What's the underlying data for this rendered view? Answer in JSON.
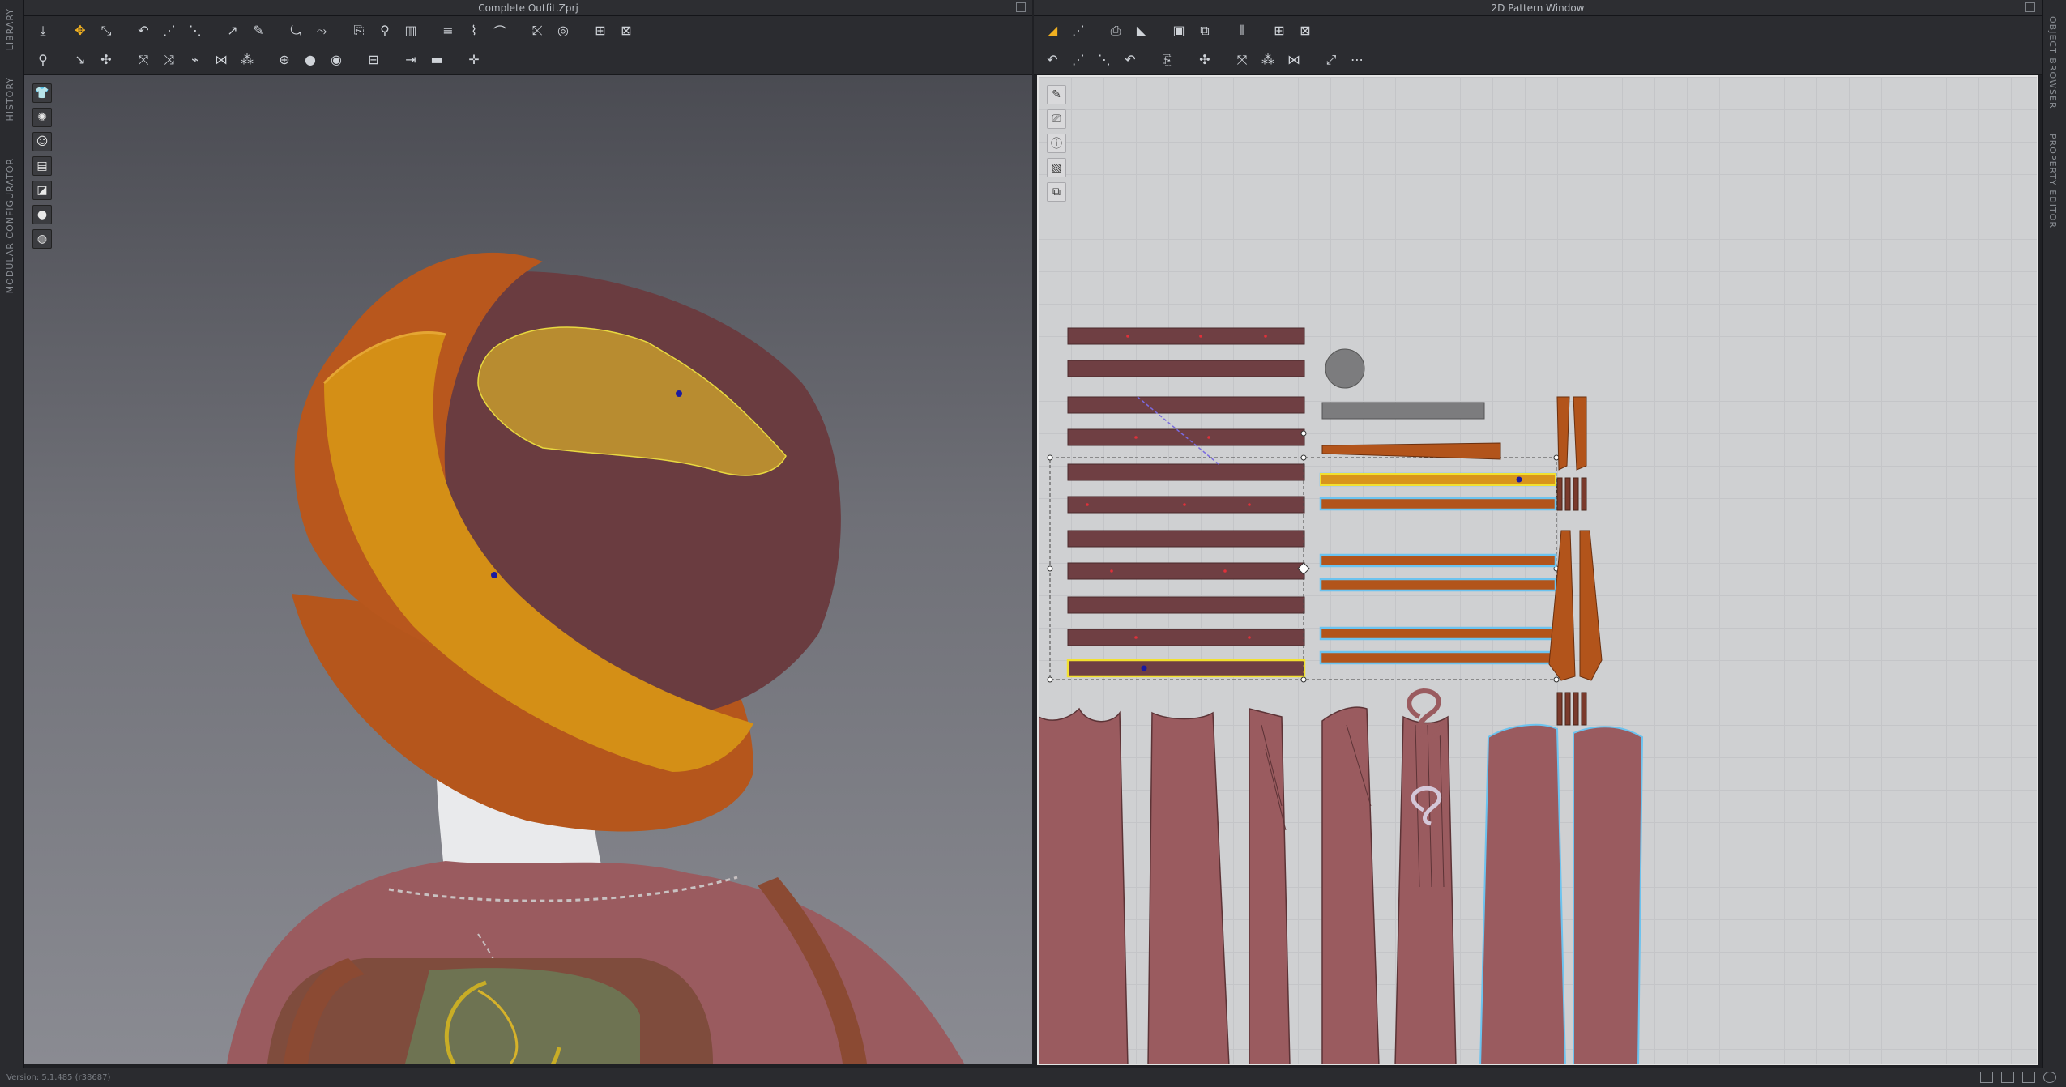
{
  "left_tabs": [
    "LIBRARY",
    "HISTORY",
    "MODULAR CONFIGURATOR"
  ],
  "right_tabs": [
    "OBJECT BROWSER",
    "PROPERTY EDITOR"
  ],
  "pane3d": {
    "title": "Complete Outfit.Zprj"
  },
  "pane2d": {
    "title": "2D Pattern Window"
  },
  "status": {
    "version": "Version: 5.1.485 (r38687)"
  },
  "colors": {
    "fabric_maroon": "#6e3e42",
    "fabric_orange": "#b2541b",
    "fabric_mustard": "#d8941c",
    "selection_yellow": "#f2e030",
    "selection_blue": "#6cc3ef",
    "pattern_grid": "#cfd0d2"
  },
  "icons": {
    "toolbar3d_row1": [
      "avatar-down-icon",
      "select-move-icon",
      "transform-icon",
      "edit-mesh-icon",
      "pin-icon",
      "fold-icon",
      "tack-icon",
      "seam-icon",
      "line-icon",
      "trace-icon",
      "sketch-icon",
      "fit-icon",
      "hanger-icon",
      "grid-icon",
      "grid2-icon"
    ],
    "toolbar3d_row2": [
      "pose-icon",
      "point-icon",
      "arrange-icon",
      "strap-icon",
      "button-icon",
      "topstitch-icon",
      "zipper-icon",
      "measure-icon",
      "tape-icon",
      "fabric-icon",
      "avatar-measure-icon",
      "ruler-icon",
      "steam-icon",
      "align-icon"
    ],
    "toolbar2d_row1": [
      "transform-pattern-icon",
      "edit-point-icon",
      "add-point-icon",
      "rectangle-icon",
      "polygon-icon",
      "internal-icon",
      "segment-sewing-icon",
      "free-sewing-icon",
      "grid-icon",
      "grid2-icon"
    ],
    "toolbar2d_row2": [
      "edit-sewing-icon",
      "check-sewing-icon",
      "fold-arrange-icon",
      "pin-icon",
      "tack-icon",
      "topstitch-icon",
      "pucker-icon",
      "texture-icon",
      "zoom-icon",
      "notch-icon"
    ]
  }
}
